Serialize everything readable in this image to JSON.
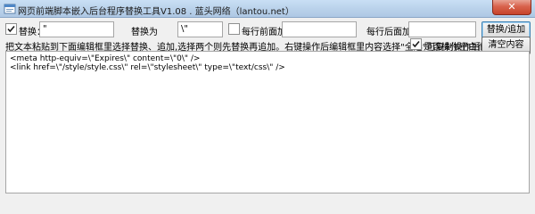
{
  "window": {
    "title": "网页前端脚本嵌入后台程序替换工具V1.08 . 蓝头网络（lantou.net）",
    "close_glyph": "✕"
  },
  "controls": {
    "replace_checkbox_label": "替换：",
    "find_value": "\"",
    "replace_with_label": "替换为",
    "replace_value": "\\\"",
    "prefix_checkbox_label": "每行前面加:",
    "prefix_value": "",
    "suffix_label": "每行后面加:",
    "suffix_value": "",
    "replace_button": "替换/追加",
    "clear_button": "清空内容",
    "instructions": "把文本粘贴到下面编辑框里选择替换、追加,选择两个则先替换再追加。右键操作后编辑框里内容选择\"全选\"可复制操作后的内容。",
    "skip_blank_label": "是否操作空白行?"
  },
  "editor": {
    "lines": [
      "<meta http-equiv=\\\"Expires\\\" content=\\\"0\\\" />",
      "<link href=\\\"/style/style.css\\\" rel=\\\"stylesheet\\\" type=\\\"text/css\\\" />"
    ]
  },
  "state": {
    "replace_checked": true,
    "prefix_checked": false,
    "skip_blank_checked": true
  }
}
